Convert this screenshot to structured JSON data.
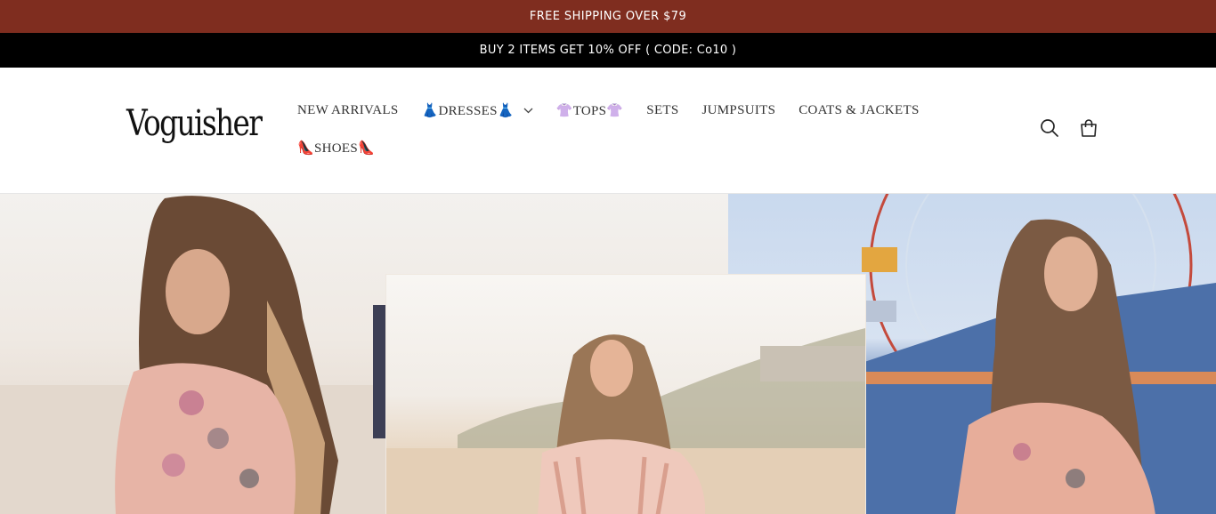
{
  "announcements": {
    "shipping": "FREE SHIPPING OVER $79",
    "promo": "BUY 2 ITEMS GET 10% OFF ( CODE: Co10 )"
  },
  "header": {
    "logo": "Voguisher",
    "nav": [
      {
        "label": "NEW ARRIVALS"
      },
      {
        "label": "👗DRESSES👗",
        "has_dropdown": true
      },
      {
        "label": "👚TOPS👚"
      },
      {
        "label": "SETS"
      },
      {
        "label": "JUMPSUITS"
      },
      {
        "label": "COATS & JACKETS"
      },
      {
        "label": "👠SHOES👠"
      }
    ],
    "icons": [
      "search-icon",
      "cart-icon"
    ]
  },
  "hero": {
    "images": [
      "woman-floral-top-beach-left",
      "woman-striped-top-beach-center",
      "woman-floral-top-ferris-wheel-right"
    ]
  },
  "colors": {
    "announcement_bg": "#7f2d1f",
    "promo_bg": "#000000"
  }
}
